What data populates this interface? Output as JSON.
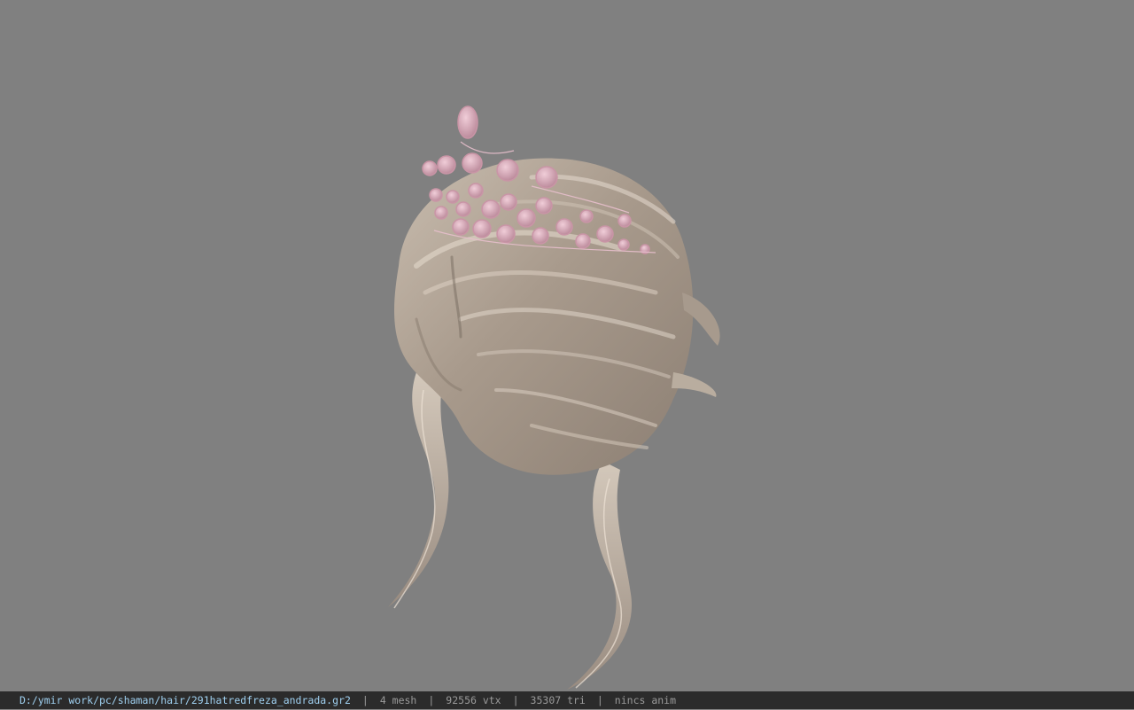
{
  "viewer": {
    "background": "#808080",
    "model_name": "hair model with pink tiara"
  },
  "status": {
    "path": "D:/ymir work/pc/shaman/hair/291hatredfreza_andrada.gr2",
    "separator": "|",
    "mesh": "4 mesh",
    "vtx": "92556 vtx",
    "tri": "35307 tri",
    "anim": "nincs anim"
  },
  "colors": {
    "hair_light": "#d9cdbf",
    "hair_mid": "#b3a597",
    "hair_dark": "#7e7166",
    "tiara": "#d9a7b6",
    "statusbar_bg": "#2b2b2b",
    "path_text": "#9fd0f0"
  }
}
